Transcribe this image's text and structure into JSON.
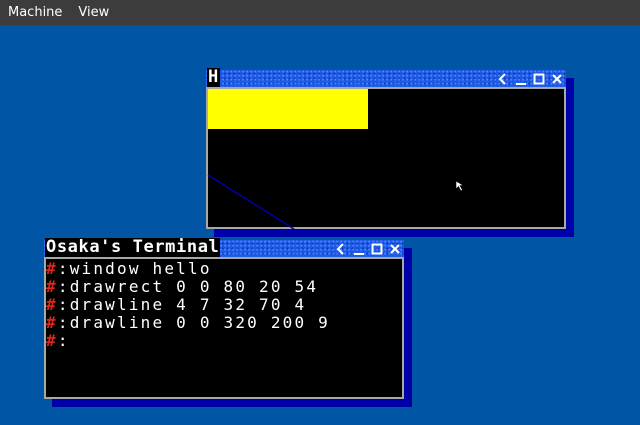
{
  "menubar": {
    "items": [
      {
        "label": "Machine"
      },
      {
        "label": "View"
      }
    ]
  },
  "windows": {
    "graphics": {
      "title": "H",
      "fill_color": "#ffff00",
      "line_color": "#0000a8"
    },
    "terminal": {
      "title": "Osaka's Terminal",
      "prompt_symbol": "#",
      "prompt_separator": ":",
      "lines": [
        "window hello",
        "drawrect 0 0 80 20 54",
        "drawline 4 7 32 70 4",
        "drawline 0 0 320 200 9",
        ""
      ]
    }
  },
  "colors": {
    "desktop": "#0055a4",
    "titlebar": "#1c5ae6",
    "shadow": "#0000a8",
    "prompt": "#e0261c"
  },
  "icons": [
    "back-arrow-icon",
    "minimize-icon",
    "maximize-icon",
    "close-icon",
    "mouse-pointer-icon"
  ]
}
